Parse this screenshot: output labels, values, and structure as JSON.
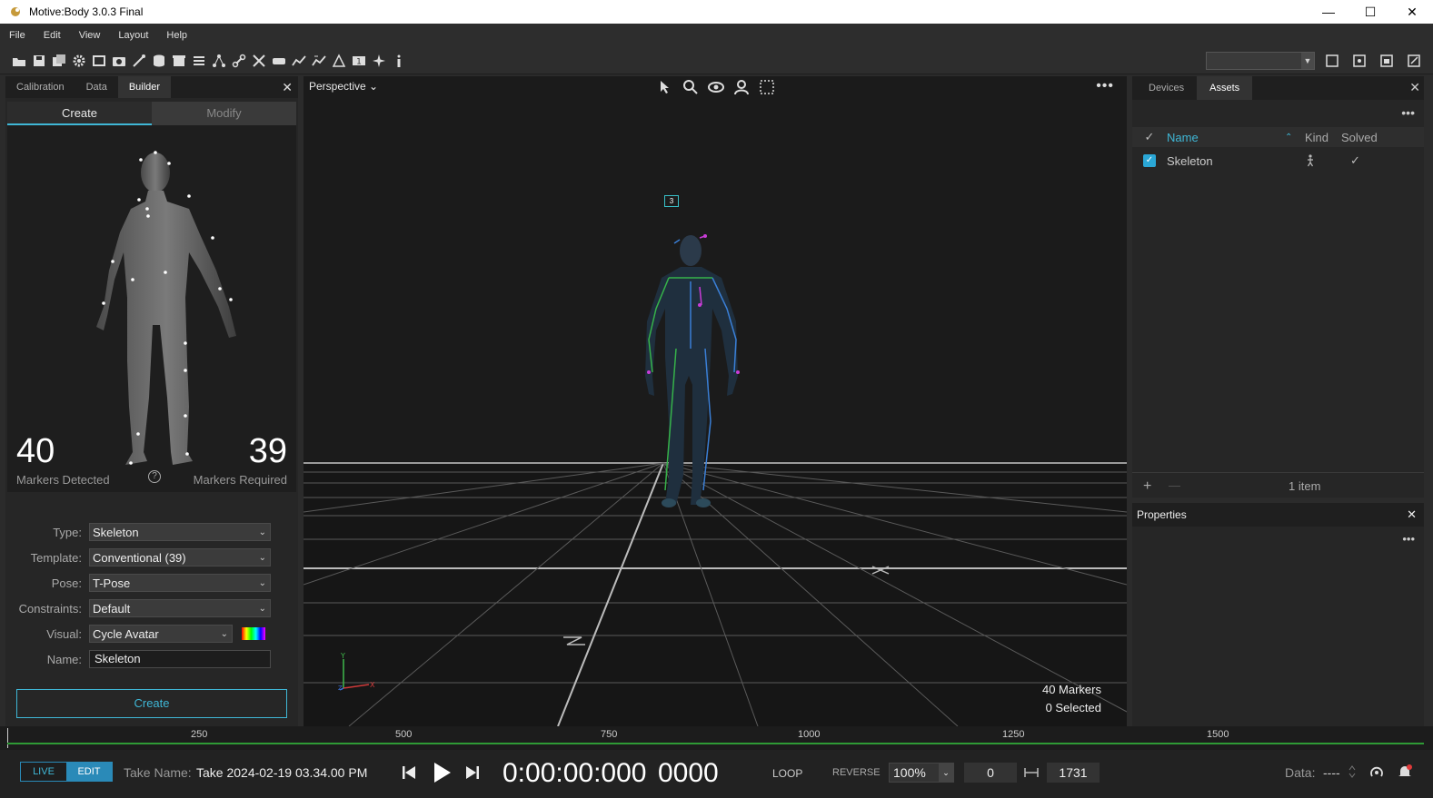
{
  "window": {
    "title": "Motive:Body 3.0.3 Final",
    "minimize": "—",
    "maximize": "☐",
    "close": "✕"
  },
  "menu": [
    "File",
    "Edit",
    "View",
    "Layout",
    "Help"
  ],
  "left_panel": {
    "tabs": [
      "Calibration",
      "Data",
      "Builder"
    ],
    "active_tab": "Builder",
    "close": "✕",
    "subtabs": [
      "Create",
      "Modify"
    ],
    "markers_detected": "40",
    "markers_detected_label": "Markers Detected",
    "markers_required": "39",
    "markers_required_label": "Markers Required",
    "help": "?",
    "form": {
      "type_label": "Type:",
      "type_value": "Skeleton",
      "template_label": "Template:",
      "template_value": "Conventional (39)",
      "pose_label": "Pose:",
      "pose_value": "T-Pose",
      "constraints_label": "Constraints:",
      "constraints_value": "Default",
      "visual_label": "Visual:",
      "visual_value": "Cycle Avatar",
      "name_label": "Name:",
      "name_value": "Skeleton"
    },
    "create_button": "Create"
  },
  "viewport": {
    "view_mode": "Perspective",
    "view_mode_chev": "⌄",
    "more": "•••",
    "asset_badge": "3",
    "markers": "40 Markers",
    "selected": "0 Selected",
    "axis_y": "Y",
    "axis_x": "X",
    "axis_z": "Z"
  },
  "assets_panel": {
    "tabs": [
      "Devices",
      "Assets"
    ],
    "active_tab": "Assets",
    "close": "✕",
    "more": "•••",
    "columns": {
      "check": "✓",
      "name": "Name",
      "kind": "Kind",
      "solved": "Solved"
    },
    "rows": [
      {
        "checked": "✓",
        "name": "Skeleton",
        "kind": "person-icon",
        "solved": "✓"
      }
    ],
    "add": "+",
    "remove": "—",
    "count": "1 item"
  },
  "properties_panel": {
    "title": "Properties",
    "close": "✕",
    "more": "•••"
  },
  "timeline": {
    "ticks": [
      "250",
      "500",
      "750",
      "1000",
      "1250",
      "1500"
    ]
  },
  "transport": {
    "live": "LIVE",
    "edit": "EDIT",
    "take_label": "Take Name:",
    "take_value": "Take 2024-02-19 03.34.00 PM",
    "timecode": "0:00:00:000",
    "frame": "0000",
    "loop": "LOOP",
    "reverse": "REVERSE",
    "speed": "100%",
    "start_frame": "0",
    "end_frame": "1731",
    "data_label": "Data:",
    "data_value": "----"
  },
  "colors": {
    "accent": "#3fb7d6",
    "timeline_green": "#2e9a35",
    "panel_bg": "#262626",
    "viewport_bg": "#1a1a1a"
  }
}
